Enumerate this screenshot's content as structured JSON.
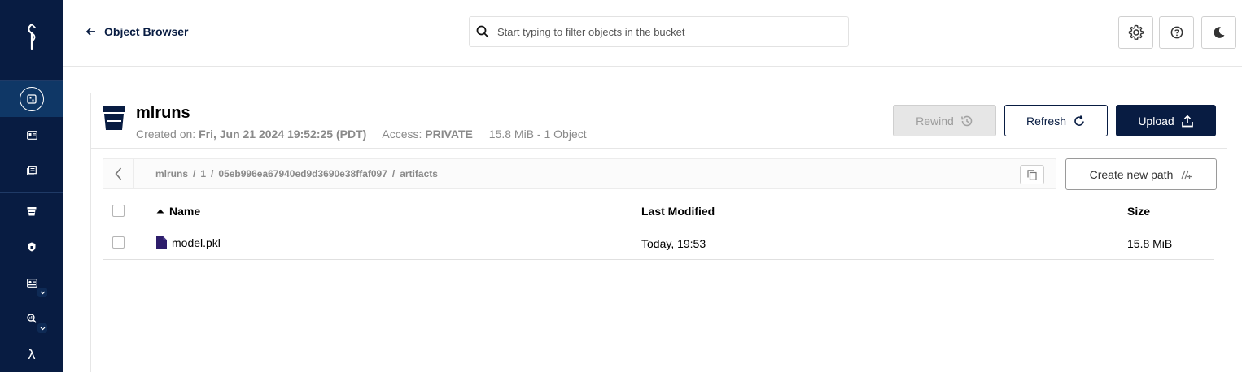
{
  "header": {
    "back_label": "Object Browser",
    "search_placeholder": "Start typing to filter objects in the bucket"
  },
  "sidebar": {
    "items": [
      {
        "icon": "object-browser-icon",
        "active": true
      },
      {
        "icon": "access-keys-icon"
      },
      {
        "icon": "documentation-icon"
      },
      {
        "icon": "buckets-icon"
      },
      {
        "icon": "policies-icon"
      },
      {
        "icon": "identity-icon",
        "has_submenu": true
      },
      {
        "icon": "monitoring-icon",
        "has_submenu": true
      },
      {
        "icon": "events-lambda-icon",
        "glyph": "λ"
      }
    ]
  },
  "bucket": {
    "name": "mlruns",
    "created_label": "Created on:",
    "created_value": "Fri, Jun 21 2024 19:52:25 (PDT)",
    "access_label": "Access:",
    "access_value": "PRIVATE",
    "summary": "15.8 MiB - 1 Object",
    "buttons": {
      "rewind": "Rewind",
      "refresh": "Refresh",
      "upload": "Upload"
    }
  },
  "breadcrumb": {
    "segments": [
      "mlruns",
      "1",
      "05eb996ea67940ed9d3690e38ffaf097",
      "artifacts"
    ],
    "separator": "/"
  },
  "create_path_label": "Create new path",
  "table": {
    "columns": {
      "name": "Name",
      "modified": "Last Modified",
      "size": "Size"
    },
    "rows": [
      {
        "name": "model.pkl",
        "modified": "Today, 19:53",
        "size": "15.8 MiB"
      }
    ]
  },
  "colors": {
    "navy": "#081c42",
    "sidebar_active": "#0f3766",
    "file_icon": "#2d1d6b",
    "muted_text": "#8a8a8a"
  }
}
